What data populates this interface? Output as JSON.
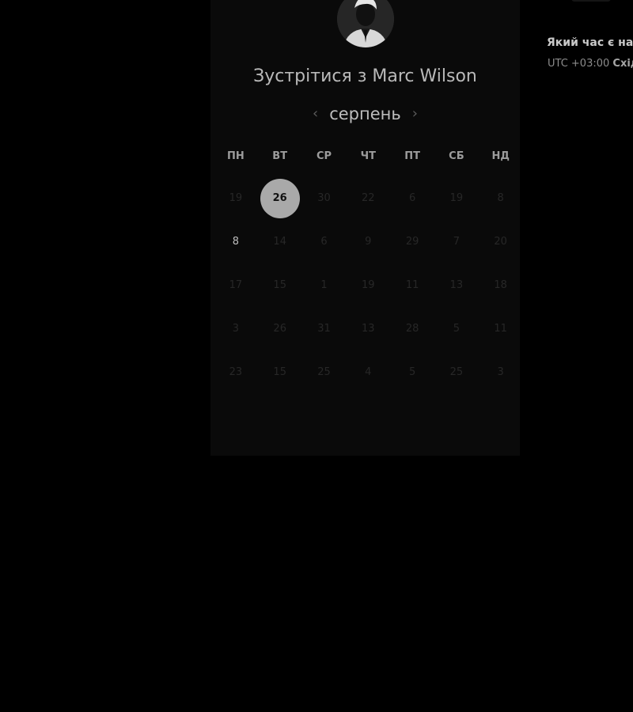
{
  "title": "Зустрітися з Marc Wilson",
  "month_nav": {
    "prev_icon": "‹",
    "month": "серпень",
    "next_icon": "›"
  },
  "weekdays": [
    "ПН",
    "ВТ",
    "СР",
    "ЧТ",
    "ПТ",
    "СБ",
    "НД"
  ],
  "days": [
    {
      "label": "19",
      "state": "disabled"
    },
    {
      "label": "26",
      "state": "selected"
    },
    {
      "label": "30",
      "state": "disabled"
    },
    {
      "label": "22",
      "state": "disabled"
    },
    {
      "label": "6",
      "state": "disabled"
    },
    {
      "label": "19",
      "state": "disabled"
    },
    {
      "label": "8",
      "state": "disabled"
    },
    {
      "label": "8",
      "state": "available"
    },
    {
      "label": "14",
      "state": "disabled"
    },
    {
      "label": "6",
      "state": "disabled"
    },
    {
      "label": "9",
      "state": "disabled"
    },
    {
      "label": "29",
      "state": "disabled"
    },
    {
      "label": "7",
      "state": "disabled"
    },
    {
      "label": "20",
      "state": "disabled"
    },
    {
      "label": "17",
      "state": "disabled"
    },
    {
      "label": "15",
      "state": "disabled"
    },
    {
      "label": "1",
      "state": "disabled"
    },
    {
      "label": "19",
      "state": "disabled"
    },
    {
      "label": "11",
      "state": "disabled"
    },
    {
      "label": "13",
      "state": "disabled"
    },
    {
      "label": "18",
      "state": "disabled"
    },
    {
      "label": "3",
      "state": "disabled"
    },
    {
      "label": "26",
      "state": "disabled"
    },
    {
      "label": "31",
      "state": "disabled"
    },
    {
      "label": "13",
      "state": "disabled"
    },
    {
      "label": "28",
      "state": "disabled"
    },
    {
      "label": "5",
      "state": "disabled"
    },
    {
      "label": "11",
      "state": "disabled"
    },
    {
      "label": "23",
      "state": "disabled"
    },
    {
      "label": "15",
      "state": "disabled"
    },
    {
      "label": "25",
      "state": "disabled"
    },
    {
      "label": "4",
      "state": "disabled"
    },
    {
      "label": "5",
      "state": "disabled"
    },
    {
      "label": "25",
      "state": "disabled"
    },
    {
      "label": "3",
      "state": "disabled"
    }
  ],
  "side": {
    "question": "Який час є най",
    "tz_prefix": "UTC +03:00",
    "tz_name": "Схід"
  },
  "colors": {
    "background": "#000000",
    "panel": "#0a0a0a",
    "selected_day": "#a9a9a9",
    "available_day": "#bcbcbc",
    "disabled_day": "#272727"
  },
  "icons": {
    "avatar": "person-avatar",
    "prev": "chevron-left-icon",
    "next": "chevron-right-icon"
  }
}
